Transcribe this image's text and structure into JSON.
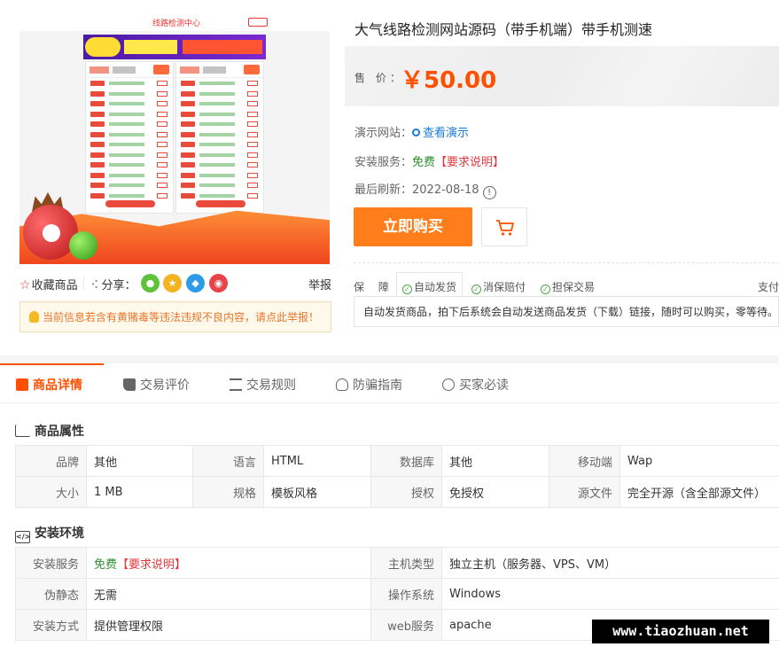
{
  "product": {
    "title": "大气线路检测网站源码（带手机端）带手机测速",
    "price_label": "售 价：",
    "price": "￥50.00"
  },
  "gallery": {
    "screenshot_title": "线路检测中心"
  },
  "share": {
    "favorite_label": "收藏商品",
    "share_label": "分享：",
    "report_label": "举报"
  },
  "notice": {
    "text": "当前信息若含有黄赌毒等违法违规不良内容，请点此举报！"
  },
  "info": {
    "demo_label": "演示网站：",
    "demo_link": "查看演示",
    "install_label": "安装服务：",
    "install_free": "免费",
    "install_req": "【要求说明】",
    "refresh_label": "最后刷新：",
    "refresh_date": "2022-08-18",
    "info_icon": "!"
  },
  "actions": {
    "buy": "立即购买"
  },
  "guarantee": {
    "label": "保 障：",
    "tags": [
      "自动发货",
      "消保赔付",
      "担保交易",
      "支付"
    ],
    "description": "自动发货商品，拍下后系统会自动发送商品发货（下载）链接，随时可以购买，零等待。"
  },
  "tabs": [
    "商品详情",
    "交易评价",
    "交易规则",
    "防骗指南",
    "买家必读"
  ],
  "attributes": {
    "title": "商品属性",
    "rows": [
      [
        [
          "品牌",
          "其他"
        ],
        [
          "语言",
          "HTML"
        ],
        [
          "数据库",
          "其他"
        ],
        [
          "移动端",
          "Wap"
        ]
      ],
      [
        [
          "大小",
          "1 MB"
        ],
        [
          "规格",
          "模板风格"
        ],
        [
          "授权",
          "免授权"
        ],
        [
          "源文件",
          "完全开源（含全部源文件）"
        ]
      ]
    ]
  },
  "environment": {
    "title": "安装环境",
    "rows": [
      {
        "k1": "安装服务",
        "v1_free": "免费",
        "v1_req": "【要求说明】",
        "k2": "主机类型",
        "v2": "独立主机（服务器、VPS、VM）"
      },
      {
        "k1": "伪静态",
        "v1": "无需",
        "k2": "操作系统",
        "v2": "Windows"
      },
      {
        "k1": "安装方式",
        "v1": "提供管理权限",
        "k2": "web服务",
        "v2": "apache"
      }
    ]
  },
  "watermark": "www.tiaozhuan.net",
  "colors": {
    "accent": "#ff5000",
    "buy_button": "#ff7d1a",
    "link": "#1a7ad8",
    "free": "#2d8d2d",
    "alert": "#e4393c"
  }
}
